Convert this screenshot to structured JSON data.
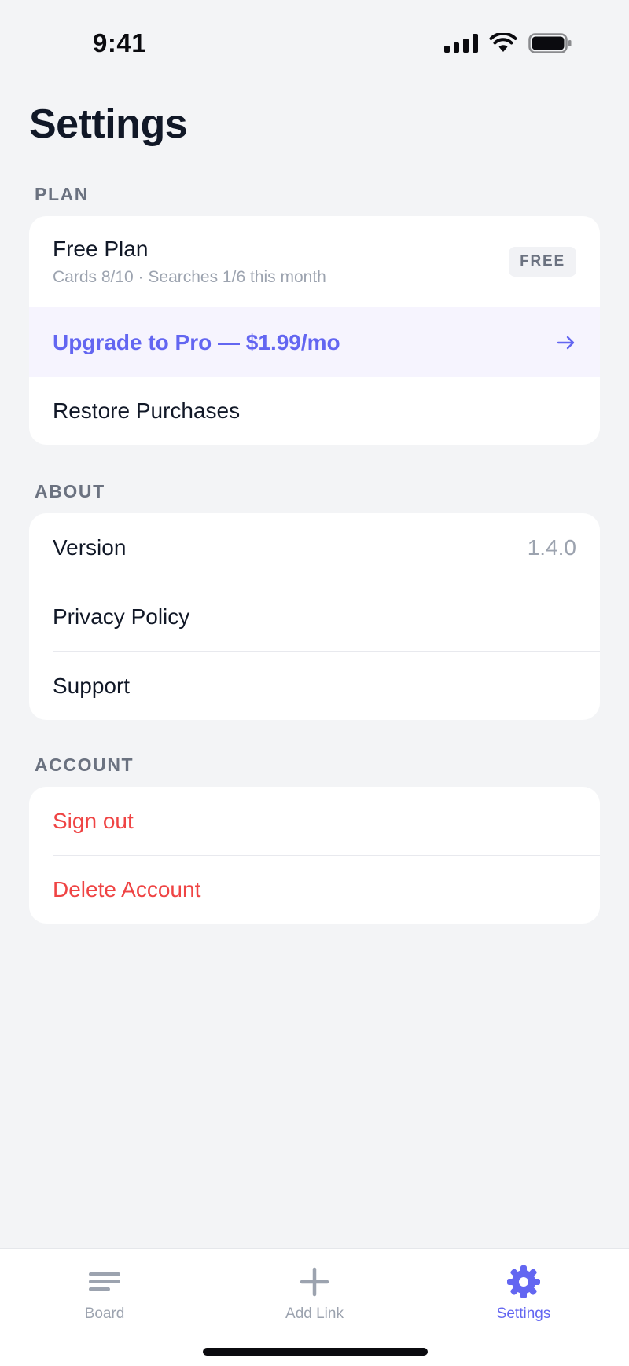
{
  "status_bar": {
    "time": "9:41"
  },
  "page": {
    "title": "Settings"
  },
  "sections": {
    "plan": {
      "label": "PLAN",
      "plan_name": "Free Plan",
      "plan_usage": "Cards 8/10 · Searches 1/6 this month",
      "badge": "FREE",
      "upgrade_label": "Upgrade to Pro — $1.99/mo",
      "restore_label": "Restore Purchases"
    },
    "about": {
      "label": "ABOUT",
      "version_label": "Version",
      "version_value": "1.4.0",
      "privacy_label": "Privacy Policy",
      "support_label": "Support"
    },
    "account": {
      "label": "ACCOUNT",
      "sign_out_label": "Sign out",
      "delete_label": "Delete Account"
    }
  },
  "tab_bar": {
    "tabs": [
      {
        "label": "Board",
        "icon": "menu-lines-icon",
        "active": false
      },
      {
        "label": "Add Link",
        "icon": "plus-icon",
        "active": false
      },
      {
        "label": "Settings",
        "icon": "gear-icon",
        "active": true
      }
    ]
  },
  "colors": {
    "accent": "#6366f1",
    "danger": "#ef4444",
    "background": "#f3f4f6",
    "upgrade_bg": "#f6f4fe"
  }
}
